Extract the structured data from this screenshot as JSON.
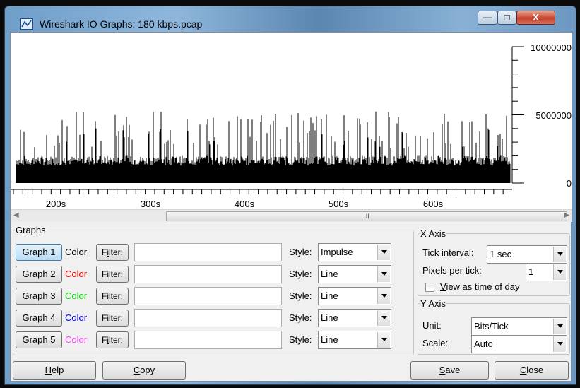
{
  "window": {
    "title": "Wireshark IO Graphs: 180 kbps.pcap",
    "minimize_label": "—",
    "maximize_label": "□",
    "close_label": "X"
  },
  "graph": {
    "y_ticks": [
      "10000000",
      "5000000",
      "0"
    ],
    "x_ticks": [
      "200s",
      "300s",
      "400s",
      "500s",
      "600s"
    ],
    "series_color": "#000000"
  },
  "scrollbar": {
    "grip": "III"
  },
  "graphs_group": {
    "legend": "Graphs",
    "color_label": "Color",
    "filter_label": "Filter:",
    "filter_accel": "i",
    "style_label": "Style:",
    "rows": [
      {
        "button": "Graph 1",
        "color": "#000000",
        "filter": "",
        "style": "Impulse"
      },
      {
        "button": "Graph 2",
        "color": "#ff0000",
        "filter": "",
        "style": "Line"
      },
      {
        "button": "Graph 3",
        "color": "#00dd00",
        "filter": "",
        "style": "Line"
      },
      {
        "button": "Graph 4",
        "color": "#0000ff",
        "filter": "",
        "style": "Line"
      },
      {
        "button": "Graph 5",
        "color": "#ff44ff",
        "filter": "",
        "style": "Line"
      }
    ]
  },
  "x_axis": {
    "legend": "X Axis",
    "tick_interval_label": "Tick interval:",
    "tick_interval_value": "1 sec",
    "pixels_per_tick_label": "Pixels per tick:",
    "pixels_per_tick_value": "1",
    "time_of_day_label": "View as time of day",
    "time_of_day_checked": false
  },
  "y_axis": {
    "legend": "Y Axis",
    "unit_label": "Unit:",
    "unit_value": "Bits/Tick",
    "scale_label": "Scale:",
    "scale_value": "Auto"
  },
  "buttons": {
    "help": "Help",
    "copy": "Copy",
    "save": "Save",
    "close": "Close"
  }
}
